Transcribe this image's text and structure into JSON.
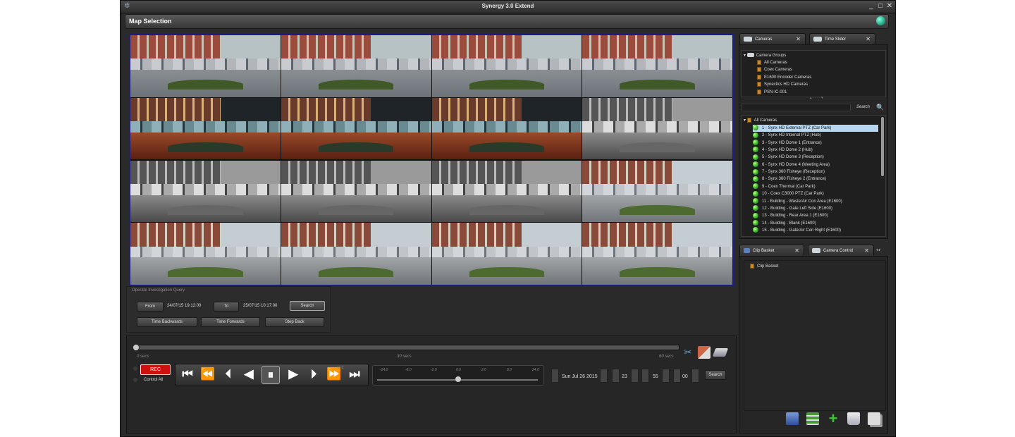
{
  "window": {
    "title": "Synergy 3.0 Extend",
    "minimize": "_",
    "maximize": "□",
    "close": "✕"
  },
  "section": {
    "title": "Map Selection"
  },
  "video_grid": {
    "tiles": [
      {
        "style": "color"
      },
      {
        "style": "color"
      },
      {
        "style": "color"
      },
      {
        "style": "color"
      },
      {
        "style": "night"
      },
      {
        "style": "night"
      },
      {
        "style": "night"
      },
      {
        "style": "bw"
      },
      {
        "style": "bw"
      },
      {
        "style": "bw"
      },
      {
        "style": "bw"
      },
      {
        "style": "day"
      },
      {
        "style": "day"
      },
      {
        "style": "day"
      },
      {
        "style": "day"
      },
      {
        "style": "day"
      }
    ],
    "border_color": "#1b1b8a"
  },
  "query": {
    "heading": "Operate Investigation Query",
    "from_label": "From",
    "from_value": "24/07/15 19:12:00",
    "to_label": "To",
    "to_value": "25/07/15 10:17:00",
    "search_label": "Search",
    "time_backwards": "Time Backwards",
    "time_forwards": "Time Forwards",
    "step_back": "Step Back"
  },
  "timeline": {
    "start_label": "0 secs",
    "mid_label": "30 secs",
    "end_label": "60 secs",
    "position": 0
  },
  "playback": {
    "rec_label": "REC",
    "control_all_label": "Control All",
    "speed_marker": "x0.0",
    "speed_ticks": [
      "-24.0",
      "-8.0",
      "-2.0",
      "0.0",
      "2.0",
      "8.0",
      "24.0"
    ],
    "date_value": "Sun Jul 26 2015",
    "hour_value": "23",
    "minute_value": "55",
    "second_value": "00",
    "search_label": "Search"
  },
  "right_panel": {
    "tabs_top": [
      {
        "label": "Cameras"
      },
      {
        "label": "Time Slider"
      }
    ],
    "camera_groups_label": "Camera Groups",
    "camera_groups": [
      "All Cameras",
      "Coex Cameras",
      "E1600 Encoder Cameras",
      "Synectics HD Cameras",
      "PSN-IC-001"
    ],
    "search_placeholder": "",
    "search_label": "Search",
    "all_cameras_label": "All Cameras",
    "cameras": [
      "1 - Synx HD External PTZ (Car Park)",
      "2 - Synx HD Internal PTZ (Hub)",
      "3 - Synx HD Dome 1 (Entrance)",
      "4 - Synx HD Dome 2 (Hub)",
      "5 - Synx HD Dome 3 (Reception)",
      "6 - Synx HD Dome 4 (Meeting Area)",
      "7 - Synx 360 Fisheye (Reception)",
      "8 - Synx 360 Fisheye 2 (Entrance)",
      "9 - Coex Thermal (Car Park)",
      "10 - Coex C3000 PTZ (Car Park)",
      "11 - Building - Waste/Air Con Area (E1600)",
      "12 - Building - Gate Left Side (E1600)",
      "13 - Building - Rear Area 1 (E1600)",
      "14 - Building - Blank (E1600)",
      "15 - Building - Gate/Air Con Right (E1600)"
    ],
    "selected_camera_index": 0,
    "tabs_bottom": [
      {
        "label": "Clip Basket"
      },
      {
        "label": "Camera Control"
      }
    ],
    "clip_basket_label": "Clip Basket",
    "toolbar_icons": [
      "save-icon",
      "add-list-icon",
      "add-icon",
      "delete-icon",
      "copy-icon"
    ]
  },
  "colors": {
    "highlight": "#b7d6f0",
    "rec": "#cc1111",
    "accent_green": "#2fa82a"
  }
}
